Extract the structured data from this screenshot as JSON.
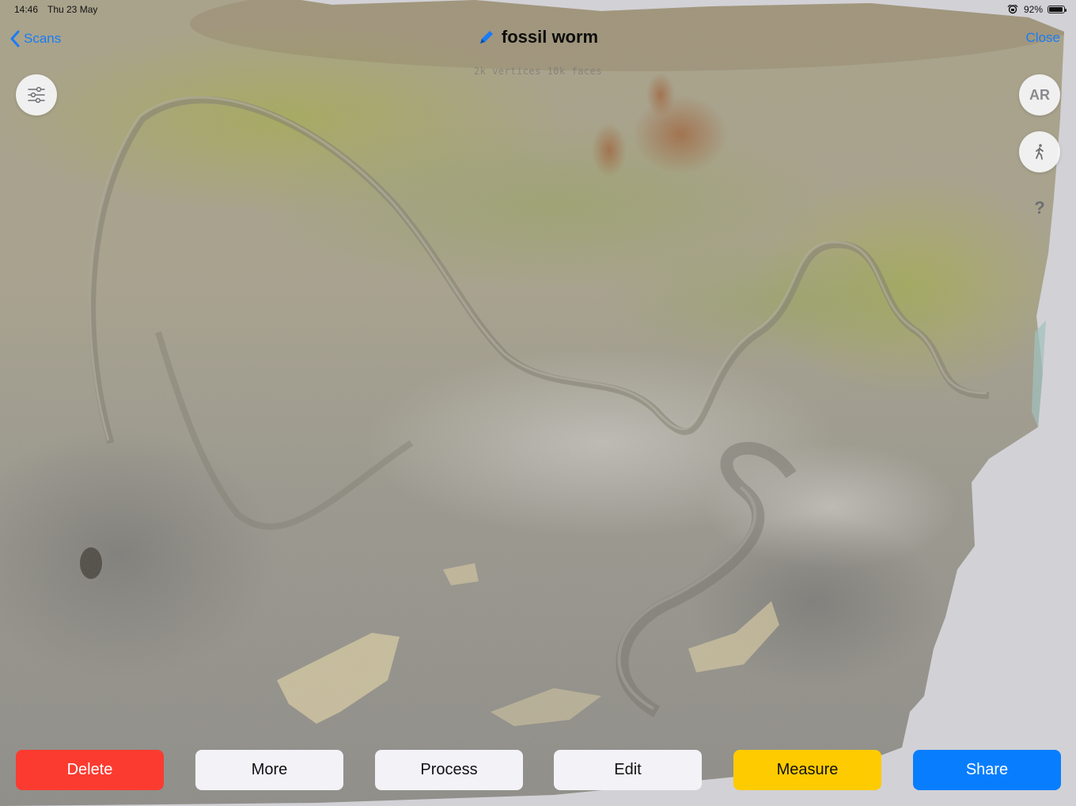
{
  "status_bar": {
    "time": "14:46",
    "date": "Thu 23 May",
    "battery": "92%",
    "battery_level": 0.92
  },
  "nav": {
    "back_label": "Scans",
    "title": "fossil worm",
    "close_label": "Close",
    "subtitle": "2k vertices 10k faces"
  },
  "controls": {
    "settings_icon": "sliders-icon",
    "ar_label": "AR",
    "walk_icon": "walking-person-icon",
    "help_label": "?"
  },
  "toolbar": {
    "delete_label": "Delete",
    "more_label": "More",
    "process_label": "Process",
    "edit_label": "Edit",
    "measure_label": "Measure",
    "share_label": "Share"
  },
  "colors": {
    "accent_blue": "#1a7cf5",
    "delete_red": "#fb3b30",
    "measure_yellow": "#fecb00",
    "share_blue": "#087efe",
    "neutral_button": "#f2f2f7",
    "background": "#d2d1d6"
  }
}
